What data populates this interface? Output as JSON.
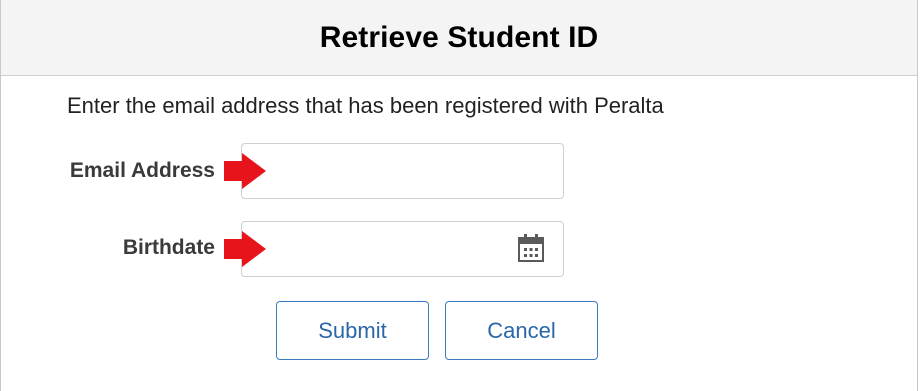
{
  "header": {
    "title": "Retrieve Student ID"
  },
  "form": {
    "instruction": "Enter the email address that has been registered with Peralta",
    "email": {
      "label": "Email Address",
      "value": "",
      "placeholder": ""
    },
    "birthdate": {
      "label": "Birthdate",
      "value": "",
      "placeholder": ""
    },
    "calendar_icon": "calendar-icon",
    "marker_icon": "red-arrow-icon"
  },
  "actions": {
    "submit_label": "Submit",
    "cancel_label": "Cancel"
  },
  "colors": {
    "header_bg": "#f4f4f4",
    "button_border": "#3b7bbf",
    "button_text": "#2a66a8",
    "arrow_red": "#e8141c"
  }
}
